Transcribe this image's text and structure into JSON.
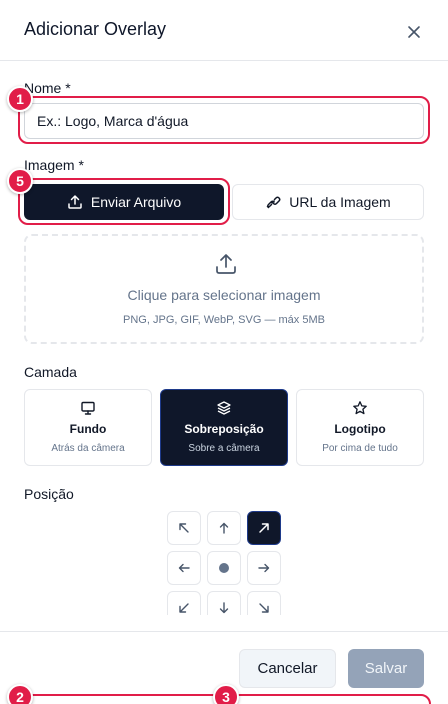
{
  "dialog": {
    "title": "Adicionar Overlay"
  },
  "name_field": {
    "label": "Nome *",
    "placeholder": "Ex.: Logo, Marca d'água"
  },
  "image_field": {
    "label": "Imagem *",
    "tabs": [
      {
        "label": "Enviar Arquivo",
        "icon": "upload-icon",
        "active": true
      },
      {
        "label": "URL da Imagem",
        "icon": "link-icon",
        "active": false
      }
    ],
    "dropzone": {
      "title": "Clique para selecionar imagem",
      "subtitle": "PNG, JPG, GIF, WebP, SVG — máx 5MB"
    }
  },
  "layer_field": {
    "label": "Camada",
    "options": [
      {
        "title": "Fundo",
        "subtitle": "Atrás da câmera",
        "icon": "monitor-icon",
        "selected": false
      },
      {
        "title": "Sobreposição",
        "subtitle": "Sobre a câmera",
        "icon": "layers-icon",
        "selected": true
      },
      {
        "title": "Logotipo",
        "subtitle": "Por cima de tudo",
        "icon": "star-icon",
        "selected": false
      }
    ]
  },
  "position_field": {
    "label": "Posição",
    "selected": "top-right",
    "options": [
      "top-left",
      "top",
      "top-right",
      "left",
      "center",
      "right",
      "bottom-left",
      "bottom",
      "bottom-right"
    ]
  },
  "footer": {
    "cancel_label": "Cancelar",
    "save_label": "Salvar"
  },
  "annotations": [
    "1",
    "5",
    "2",
    "3"
  ],
  "colors": {
    "primary": "#0f172a",
    "highlight": "#e11d48",
    "muted_text": "#64748b",
    "border": "#e5e7eb"
  }
}
